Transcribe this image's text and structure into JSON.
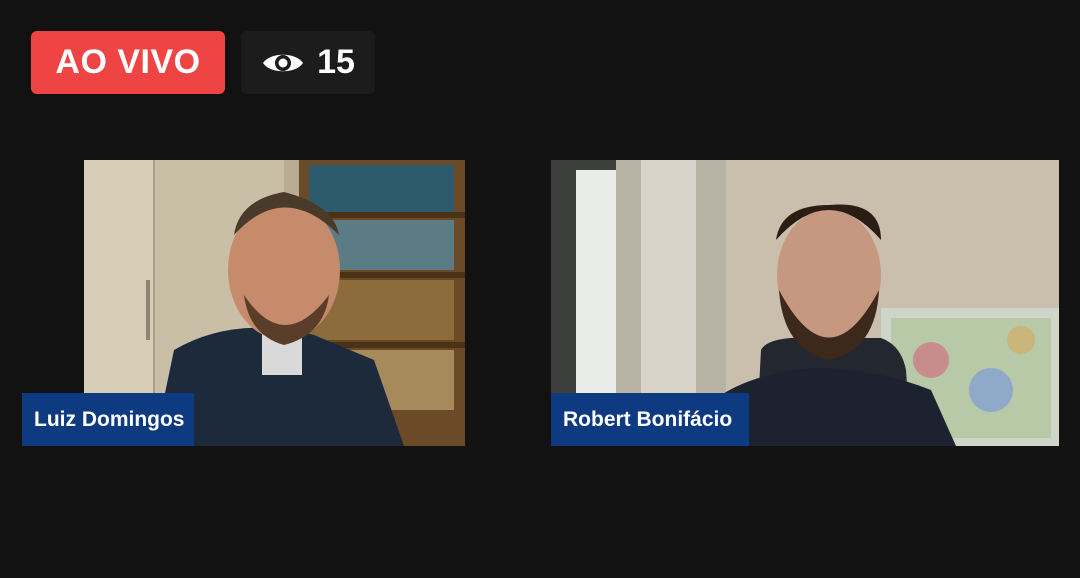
{
  "status": {
    "live_label": "AO VIVO",
    "viewer_count": "15",
    "live_color": "#ef4444"
  },
  "participants": [
    {
      "name": "Luiz Domingos"
    },
    {
      "name": "Robert Bonifácio"
    }
  ],
  "colors": {
    "background": "#121212",
    "name_tag": "#0e3a82"
  }
}
